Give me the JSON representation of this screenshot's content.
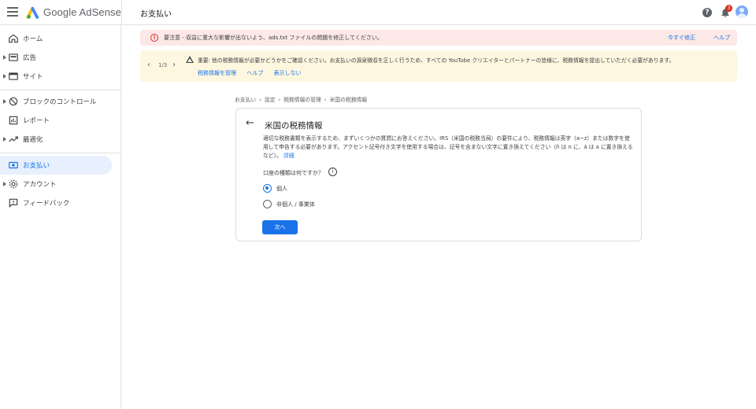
{
  "app": {
    "brand": "Google AdSense",
    "page_title": "お支払い",
    "help_icon": "help-circle-icon",
    "notification_count": "3"
  },
  "sidebar": {
    "items": [
      {
        "label": "ホーム",
        "icon": "home-icon",
        "has_caret": false,
        "active": false
      },
      {
        "label": "広告",
        "icon": "ads-icon",
        "has_caret": true,
        "active": false
      },
      {
        "label": "サイト",
        "icon": "sites-icon",
        "has_caret": true,
        "active": false
      },
      {
        "label": "ブロックのコントロール",
        "icon": "block-icon",
        "has_caret": true,
        "active": false
      },
      {
        "label": "レポート",
        "icon": "reports-icon",
        "has_caret": false,
        "active": false
      },
      {
        "label": "最適化",
        "icon": "optimization-icon",
        "has_caret": true,
        "active": false
      },
      {
        "label": "お支払い",
        "icon": "payments-icon",
        "has_caret": false,
        "active": true
      },
      {
        "label": "アカウント",
        "icon": "account-gear-icon",
        "has_caret": true,
        "active": false
      },
      {
        "label": "フィードバック",
        "icon": "feedback-icon",
        "has_caret": false,
        "active": false
      }
    ]
  },
  "alerts": {
    "red": {
      "text": "要注意 - 収益に重大な影響が出ないよう、ads.txt ファイルの問題を修正してください。",
      "fix_link": "今すぐ修正",
      "help_link": "ヘルプ"
    },
    "yellow": {
      "pager": "1/3",
      "text": "重要: 他の税務情報が必要かどうかをご確認ください。お支払いの源泉徴収を正しく行うため、すべての YouTube クリエイターとパートナーの皆様に、税務情報を提出していただく必要があります。",
      "links": [
        "税務情報を管理",
        "ヘルプ",
        "表示しない"
      ]
    }
  },
  "breadcrumb": [
    "お支払い",
    "設定",
    "税務情報の管理",
    "米国の税務情報"
  ],
  "card": {
    "title": "米国の税務情報",
    "description": "適切な税務書類を表示するため、まずいくつかの質問にお答えください。IRS（米国の税務当局）の要件により、税務情報は英字（a~z）または数字を使用して申告する必要があります。アクセント記号付き文字を使用する場合は、記号を含まない文字に置き換えてください（ñ は n に、á は a に置き換えるなど）。",
    "details_link": "詳細",
    "question": "口座の種類は何ですか？",
    "options": [
      {
        "label": "個人",
        "selected": true
      },
      {
        "label": "非個人 / 事業体",
        "selected": false
      }
    ],
    "next_button": "次へ"
  },
  "colors": {
    "accent": "#1a73e8",
    "error_bg": "#fce8e6",
    "warning_bg": "#fef7e0",
    "active_nav_bg": "#e8f0fe"
  }
}
